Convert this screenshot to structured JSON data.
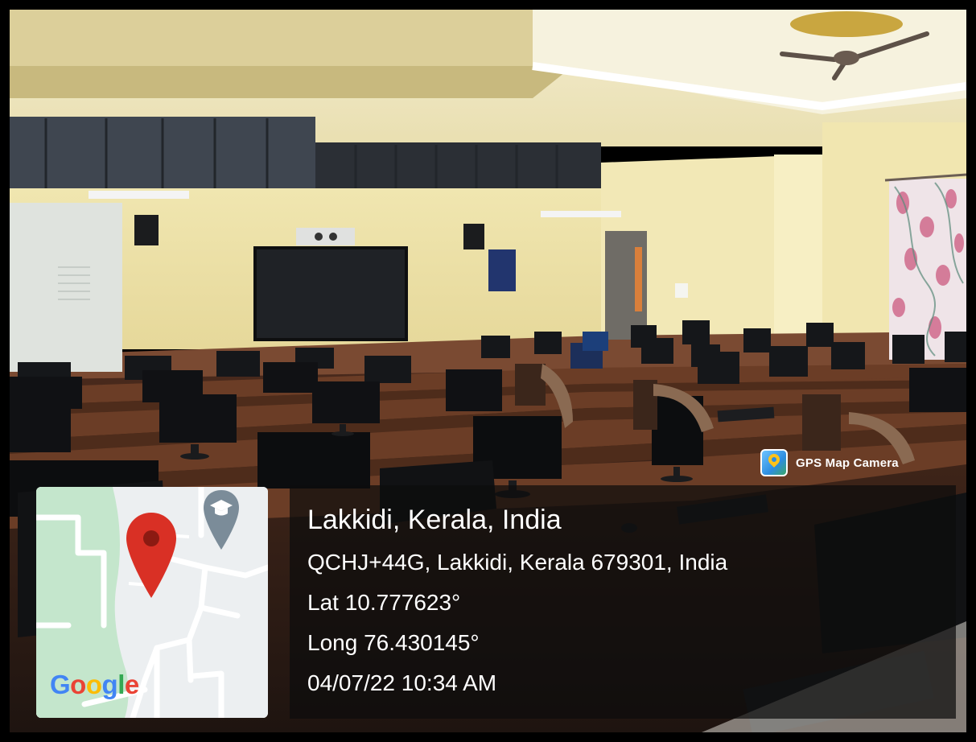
{
  "badge": {
    "label": "GPS Map Camera",
    "icon": "gps-map-camera-icon"
  },
  "location": {
    "title": "Lakkidi, Kerala, India",
    "address": "QCHJ+44G, Lakkidi, Kerala 679301, India",
    "latitude": "Lat 10.777623°",
    "longitude": "Long 76.430145°",
    "timestamp": "04/07/22 10:34 AM"
  },
  "map": {
    "logo_text": "Google",
    "marker_icon": "map-pin-icon",
    "poi_icon": "school-cap-icon",
    "colors": {
      "marker": "#d93025",
      "poi": "#7b8c99",
      "green_area": "#c4e6cc",
      "land": "#eceff1"
    }
  },
  "colors": {
    "wall": "#efe3a8",
    "wainscot": "#7a4a32",
    "desk": "#5a3422",
    "panel_overlay": "#0c0c0c"
  }
}
